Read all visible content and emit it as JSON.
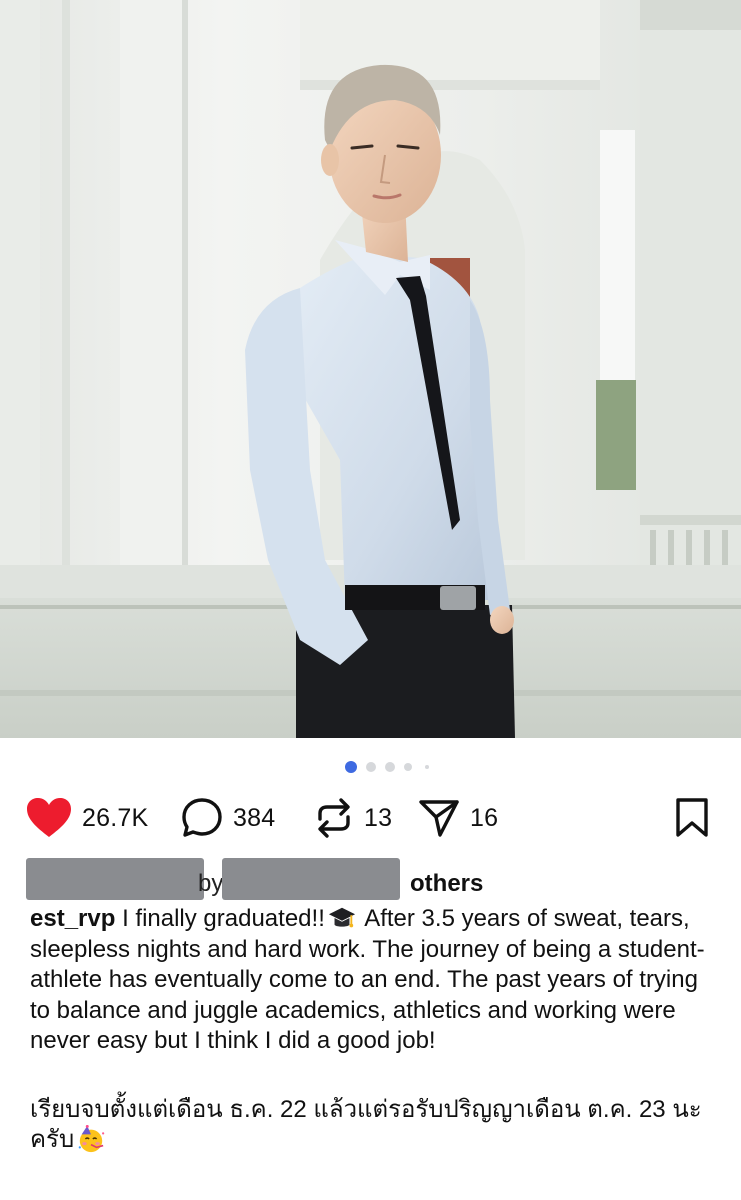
{
  "post": {
    "image_alt": "Young man with light grey hair in white shirt, black tie and black trousers leaning on a white balustrade in front of ornate white architecture",
    "carousel": {
      "total_dots": 5,
      "active_index": 0
    }
  },
  "actions": {
    "likes": {
      "icon": "heart-icon",
      "count": "26.7K"
    },
    "comments": {
      "icon": "comment-icon",
      "count": "384"
    },
    "reposts": {
      "icon": "repost-icon",
      "count": "13"
    },
    "shares": {
      "icon": "send-icon",
      "count": "16"
    },
    "save": {
      "icon": "bookmark-icon"
    }
  },
  "liked_by": {
    "by_fragment": "by",
    "others": "others"
  },
  "caption": {
    "username": "est_rvp",
    "text_1": "I finally graduated!!",
    "text_2": "After 3.5 years of sweat,  tears, sleepless nights and hard work. The journey of being a student-athlete has eventually come to an end. The past years of trying to balance and juggle academics, athletics and working were never easy but I think I did a good job!",
    "thai_1": "เรียบจบตั้งแต่เดือน ธ.ค. 22  แล้วแต่รอรับปริญญาเดือน ต.ค. 23 นะครับ",
    "emoji_1": "graduation-cap-icon",
    "emoji_2": "party-face-icon"
  },
  "colors": {
    "like_red": "#ed1c2e",
    "dot_active": "#3e6ae1",
    "dot_inactive": "#d6d8db",
    "redaction": "#8a8c90"
  }
}
